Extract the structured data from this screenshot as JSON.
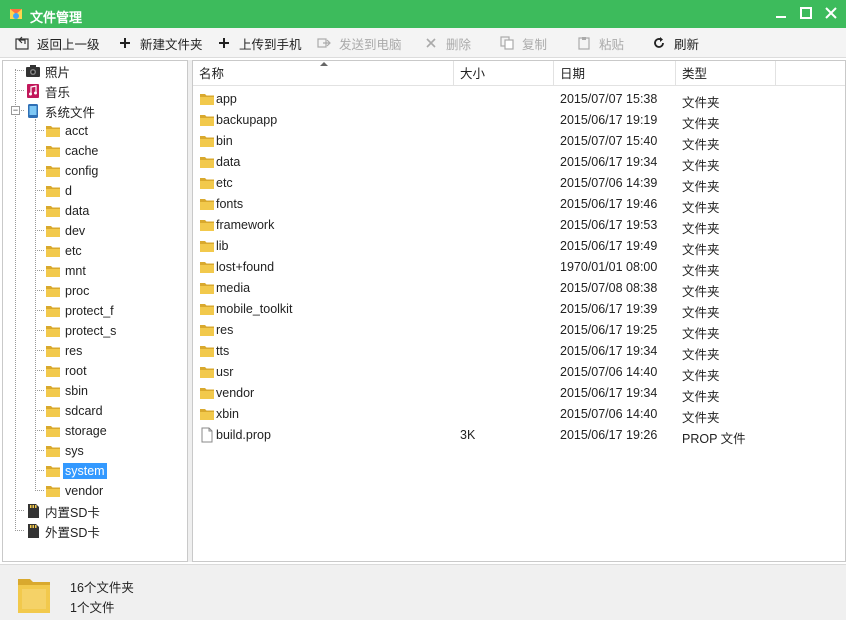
{
  "window": {
    "title": "文件管理"
  },
  "toolbar": {
    "back": "返回上一级",
    "new_folder": "新建文件夹",
    "upload": "上传到手机",
    "send_to_pc": "发送到电脑",
    "delete": "删除",
    "copy": "复制",
    "paste": "粘贴",
    "refresh": "刷新"
  },
  "tree": {
    "photos": "照片",
    "music": "音乐",
    "system_files": "系统文件",
    "folders": [
      "acct",
      "cache",
      "config",
      "d",
      "data",
      "dev",
      "etc",
      "mnt",
      "proc",
      "protect_f",
      "protect_s",
      "res",
      "root",
      "sbin",
      "sdcard",
      "storage",
      "sys",
      "system",
      "vendor"
    ],
    "selected": "system",
    "internal_sd": "内置SD卡",
    "external_sd": "外置SD卡"
  },
  "columns": {
    "name": "名称",
    "size": "大小",
    "date": "日期",
    "type": "类型"
  },
  "files": [
    {
      "name": "app",
      "size": "",
      "date": "2015/07/07 15:38",
      "type": "文件夹",
      "kind": "folder"
    },
    {
      "name": "backupapp",
      "size": "",
      "date": "2015/06/17 19:19",
      "type": "文件夹",
      "kind": "folder"
    },
    {
      "name": "bin",
      "size": "",
      "date": "2015/07/07 15:40",
      "type": "文件夹",
      "kind": "folder"
    },
    {
      "name": "data",
      "size": "",
      "date": "2015/06/17 19:34",
      "type": "文件夹",
      "kind": "folder"
    },
    {
      "name": "etc",
      "size": "",
      "date": "2015/07/06 14:39",
      "type": "文件夹",
      "kind": "folder"
    },
    {
      "name": "fonts",
      "size": "",
      "date": "2015/06/17 19:46",
      "type": "文件夹",
      "kind": "folder"
    },
    {
      "name": "framework",
      "size": "",
      "date": "2015/06/17 19:53",
      "type": "文件夹",
      "kind": "folder"
    },
    {
      "name": "lib",
      "size": "",
      "date": "2015/06/17 19:49",
      "type": "文件夹",
      "kind": "folder"
    },
    {
      "name": "lost+found",
      "size": "",
      "date": "1970/01/01 08:00",
      "type": "文件夹",
      "kind": "folder"
    },
    {
      "name": "media",
      "size": "",
      "date": "2015/07/08 08:38",
      "type": "文件夹",
      "kind": "folder"
    },
    {
      "name": "mobile_toolkit",
      "size": "",
      "date": "2015/06/17 19:39",
      "type": "文件夹",
      "kind": "folder"
    },
    {
      "name": "res",
      "size": "",
      "date": "2015/06/17 19:25",
      "type": "文件夹",
      "kind": "folder"
    },
    {
      "name": "tts",
      "size": "",
      "date": "2015/06/17 19:34",
      "type": "文件夹",
      "kind": "folder"
    },
    {
      "name": "usr",
      "size": "",
      "date": "2015/07/06 14:40",
      "type": "文件夹",
      "kind": "folder"
    },
    {
      "name": "vendor",
      "size": "",
      "date": "2015/06/17 19:34",
      "type": "文件夹",
      "kind": "folder"
    },
    {
      "name": "xbin",
      "size": "",
      "date": "2015/07/06 14:40",
      "type": "文件夹",
      "kind": "folder"
    },
    {
      "name": "build.prop",
      "size": "3K",
      "date": "2015/06/17 19:26",
      "type": "PROP 文件",
      "kind": "file"
    }
  ],
  "status": {
    "folders": "16个文件夹",
    "files": "1个文件"
  },
  "colors": {
    "titlebar": "#3dbb5c",
    "selection": "#3399ff",
    "folder": "#f2c94c"
  }
}
